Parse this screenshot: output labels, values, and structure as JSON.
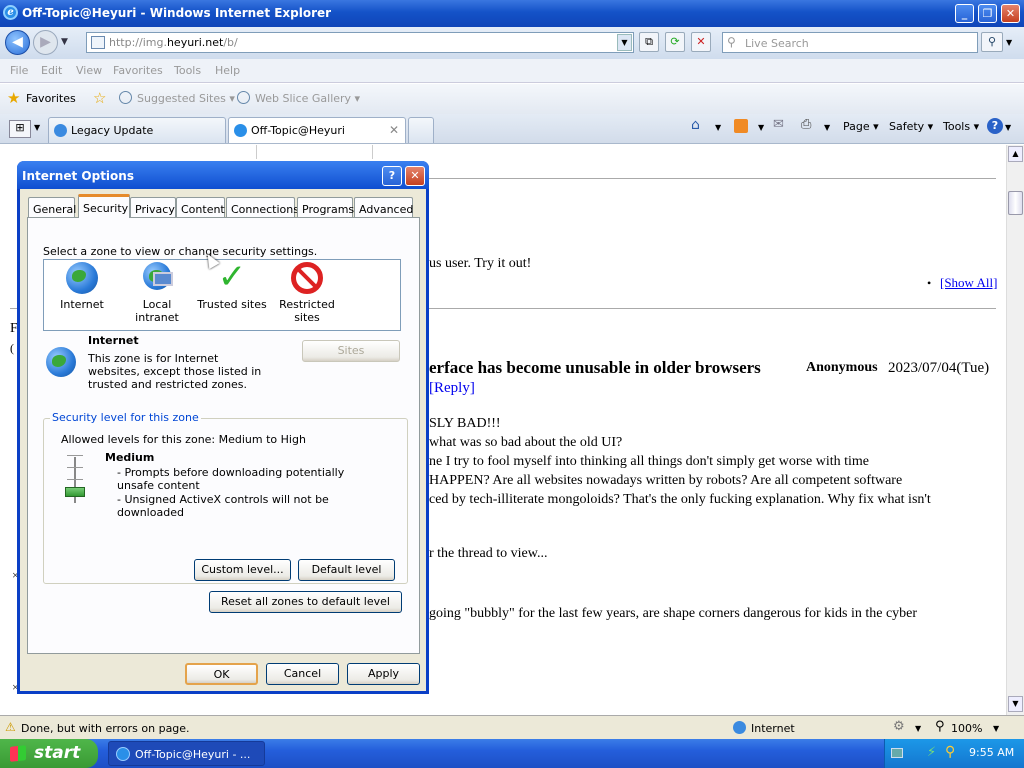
{
  "window": {
    "title": "Off-Topic@Heyuri - Windows Internet Explorer"
  },
  "address": {
    "prefix": "http://img.",
    "domain": "heyuri.net",
    "path": "/b/"
  },
  "search": {
    "placeholder": "Live Search"
  },
  "menu": [
    "File",
    "Edit",
    "View",
    "Favorites",
    "Tools",
    "Help"
  ],
  "favorites": {
    "label": "Favorites",
    "suggested": "Suggested Sites ▾",
    "webslice": "Web Slice Gallery ▾"
  },
  "tabs": [
    {
      "label": "Legacy Update"
    },
    {
      "label": "Off-Topic@Heyuri"
    }
  ],
  "commandbar": {
    "page": "Page ▾",
    "safety": "Safety ▾",
    "tools": "Tools ▾"
  },
  "page": {
    "line1": "us user. Try it out!",
    "bullet": "•",
    "showall": "[Show All]",
    "letter_f": "F",
    "letter_paren": "(",
    "post_title": "erface has become unusable in older browsers",
    "post_author": "Anonymous",
    "post_date": "2023/07/04(Tue)",
    "reply": "[Reply]",
    "l1": "SLY BAD!!!",
    "l2": "what was so bad about the old UI?",
    "l3": "ne I try to fool myself into thinking all things don't simply get worse with time",
    "l4": "HAPPEN? Are all websites nowadays written by robots? Are all competent software",
    "l5": "ced by tech-illiterate mongoloids? That's the only fucking explanation. Why fix what isn't",
    "l6": "r the thread to view...",
    "l7": "going \"bubbly\" for the last few years, are shape corners dangerous for kids in the cyber",
    "mark1": "×",
    "mark2": "×"
  },
  "status": {
    "text": "Done, but with errors on page.",
    "zone": "Internet",
    "zoom": "100%"
  },
  "taskbar": {
    "start": "start",
    "item": "Off-Topic@Heyuri - ...",
    "clock": "9:55 AM"
  },
  "dialog": {
    "title": "Internet Options",
    "tabs": [
      "General",
      "Security",
      "Privacy",
      "Content",
      "Connections",
      "Programs",
      "Advanced"
    ],
    "instruction": "Select a zone to view or change security settings.",
    "zones": [
      "Internet",
      "Local intranet",
      "Trusted sites",
      "Restricted sites"
    ],
    "zone_name": "Internet",
    "zone_desc": "This zone is for Internet websites, except those listed in trusted and restricted zones.",
    "sites_button": "Sites",
    "security_group": "Security level for this zone",
    "allowed": "Allowed levels for this zone: Medium to High",
    "level": "Medium",
    "bullet1": "- Prompts before downloading potentially unsafe content",
    "bullet2": "- Unsigned ActiveX controls will not be downloaded",
    "custom_button": "Custom level...",
    "default_button": "Default level",
    "reset_button": "Reset all zones to default level",
    "ok": "OK",
    "cancel": "Cancel",
    "apply": "Apply"
  },
  "colors": {
    "titlebar": "#1452c8",
    "taskbar": "#245edb",
    "start": "#3a9a34",
    "link": "#0000ee",
    "accent_tab": "#e68b2c"
  }
}
